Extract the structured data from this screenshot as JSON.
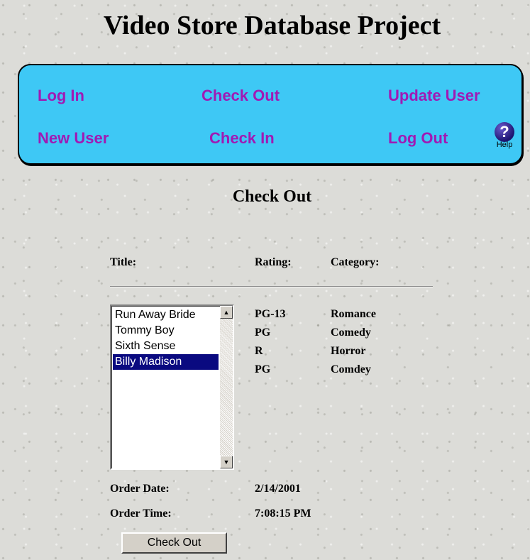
{
  "page": {
    "title": "Video Store Database Project"
  },
  "nav": {
    "log_in": "Log In",
    "check_out": "Check Out",
    "update_user": "Update User",
    "new_user": "New User",
    "check_in": "Check In",
    "log_out": "Log Out",
    "help_icon": "?",
    "help_label": "Help"
  },
  "colors": {
    "nav_bg": "#3ec8f5",
    "nav_link": "#a01ab4",
    "selection": "#0a0a80"
  },
  "main": {
    "heading": "Check Out",
    "columns": {
      "title": "Title:",
      "rating": "Rating:",
      "category": "Category:"
    },
    "movies": [
      {
        "title": "Run Away Bride",
        "rating": "PG-13",
        "category": "Romance"
      },
      {
        "title": "Tommy Boy",
        "rating": "PG",
        "category": "Comedy"
      },
      {
        "title": "Sixth Sense",
        "rating": "R",
        "category": "Horror"
      },
      {
        "title": "Billy Madison",
        "rating": "PG",
        "category": "Comdey"
      }
    ],
    "selected_title": "Billy Madison",
    "order_date_label": "Order Date:",
    "order_date": "2/14/2001",
    "order_time_label": "Order Time:",
    "order_time": "7:08:15 PM",
    "submit_label": "Check Out"
  }
}
